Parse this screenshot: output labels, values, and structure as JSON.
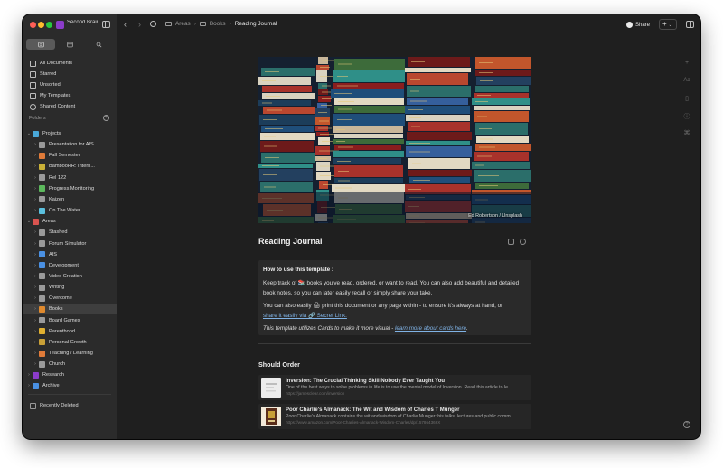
{
  "app": {
    "name": "Second Brain",
    "accent": "#8b3cc9"
  },
  "sidebar": {
    "main_items": [
      {
        "label": "All Documents",
        "icon": "documents-icon"
      },
      {
        "label": "Starred",
        "icon": "star-icon"
      },
      {
        "label": "Unsorted",
        "icon": "inbox-icon"
      },
      {
        "label": "My Templates",
        "icon": "template-icon"
      },
      {
        "label": "Shared Content",
        "icon": "shared-icon"
      }
    ],
    "folders_header": "Folders",
    "folders": [
      {
        "label": "Projects",
        "level": 0,
        "open": true,
        "color": "#4aa8d8"
      },
      {
        "label": "Presentation for AIS",
        "level": 1,
        "color": "#9a9a9a"
      },
      {
        "label": "Fall Semester",
        "level": 1,
        "color": "#e07b39"
      },
      {
        "label": "BambooHR: Intern...",
        "level": 1,
        "color": "#c9b037"
      },
      {
        "label": "Rel 122",
        "level": 1,
        "color": "#9a9a9a"
      },
      {
        "label": "Progress Monitoring",
        "level": 1,
        "color": "#5cb85c"
      },
      {
        "label": "Kaizen",
        "level": 1,
        "color": "#9a9a9a"
      },
      {
        "label": "On The Water",
        "level": 1,
        "color": "#5bc0de"
      },
      {
        "label": "Areas",
        "level": 0,
        "open": true,
        "color": "#d9534f"
      },
      {
        "label": "Stashed",
        "level": 1,
        "color": "#9a9a9a"
      },
      {
        "label": "Forum Simulator",
        "level": 1,
        "color": "#9a9a9a"
      },
      {
        "label": "AIS",
        "level": 1,
        "color": "#4a90e2"
      },
      {
        "label": "Development",
        "level": 1,
        "color": "#4a90e2"
      },
      {
        "label": "Video Creation",
        "level": 1,
        "color": "#9a9a9a"
      },
      {
        "label": "Writing",
        "level": 1,
        "color": "#9a9a9a"
      },
      {
        "label": "Overcome",
        "level": 1,
        "color": "#9a9a9a"
      },
      {
        "label": "Books",
        "level": 1,
        "color": "#e08a2e",
        "selected": true
      },
      {
        "label": "Board Games",
        "level": 1,
        "color": "#9a9a9a"
      },
      {
        "label": "Parenthood",
        "level": 1,
        "color": "#e0b030"
      },
      {
        "label": "Personal Growth",
        "level": 1,
        "color": "#c9a037"
      },
      {
        "label": "Teaching / Learning",
        "level": 1,
        "color": "#e07b39"
      },
      {
        "label": "Church",
        "level": 1,
        "color": "#9a9a9a"
      },
      {
        "label": "Research",
        "level": 0,
        "color": "#8b3cc9"
      },
      {
        "label": "Archive",
        "level": 0,
        "color": "#4a90e2"
      }
    ],
    "recently_deleted": "Recently Deleted"
  },
  "breadcrumb": [
    "Areas",
    "Books",
    "Reading Journal"
  ],
  "toolbar": {
    "share_label": "Share",
    "add_label": "+"
  },
  "cover": {
    "credit": "Ed Robertson / Unsplash"
  },
  "document": {
    "title": "Reading Journal",
    "callout": {
      "heading": "How to use this template :",
      "p1_a": "Keep track of 📚 books you've read, ordered, or want to read. You can also add beautiful and detailed book notes, so you can later easily recall or simply share your take.",
      "p2_a": "You can also easily 🖨 print this document or any page within - to ensure it's always at hand, or",
      "p2_link": "share it easily via 🔗 Secret Link.",
      "p3_a": "This template utilizes Cards to make it more visual -",
      "p3_link": "learn more about cards here"
    },
    "section_title": "Should Order",
    "cards": [
      {
        "title": "Inversion: The Crucial Thinking Skill Nobody Ever Taught You",
        "desc": "One of the best ways to solve problems in life is to use the mental model of Inversion. Read this article to le...",
        "url": "https://jamesclear.com/inversion"
      },
      {
        "title": "Poor Charlie's Almanack: The Wit and Wisdom of Charles T Munger",
        "desc": "Poor Charlie's Almanack contains the wit and wisdom of Charlie Munger: his talks, lectures and public comm...",
        "url": "https://www.amazon.com/Poor-Charlies-Almanack-Wisdom-Charles/dp/157864366X"
      }
    ]
  }
}
